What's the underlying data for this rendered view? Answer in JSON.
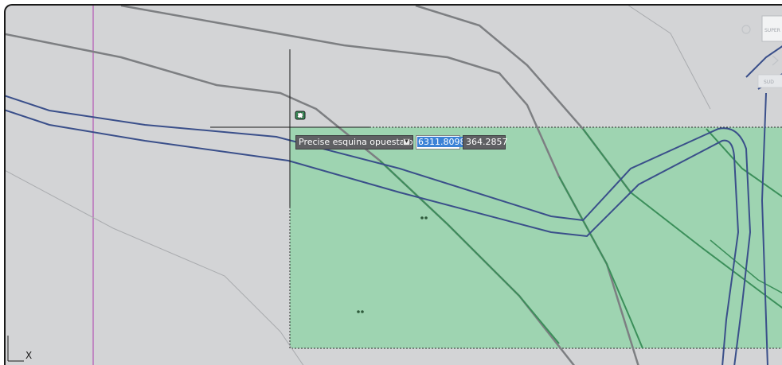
{
  "colors": {
    "canvas_background": "#d3d4d6",
    "selection_fill": "#9ed4b1",
    "road_outline": "#3a4f8a",
    "contour_line": "#7d7f82",
    "magenta_line": "#b556b5",
    "green_line": "#3b8f5a"
  },
  "dynamic_input": {
    "prompt": "Precise esquina opuesta o",
    "x_value": "6311.8098",
    "y_value": "364.2857",
    "dropdown_icon": "down-arrow-icon"
  },
  "viewcube": {
    "face_label": "SUPER",
    "compass_label": "SUD"
  },
  "ucs": {
    "icon": "ucs-axis-icon",
    "axis_label": "X"
  },
  "cursor": {
    "icon": "crosshair-cursor-icon",
    "badge_icon": "window-select-badge-icon"
  }
}
